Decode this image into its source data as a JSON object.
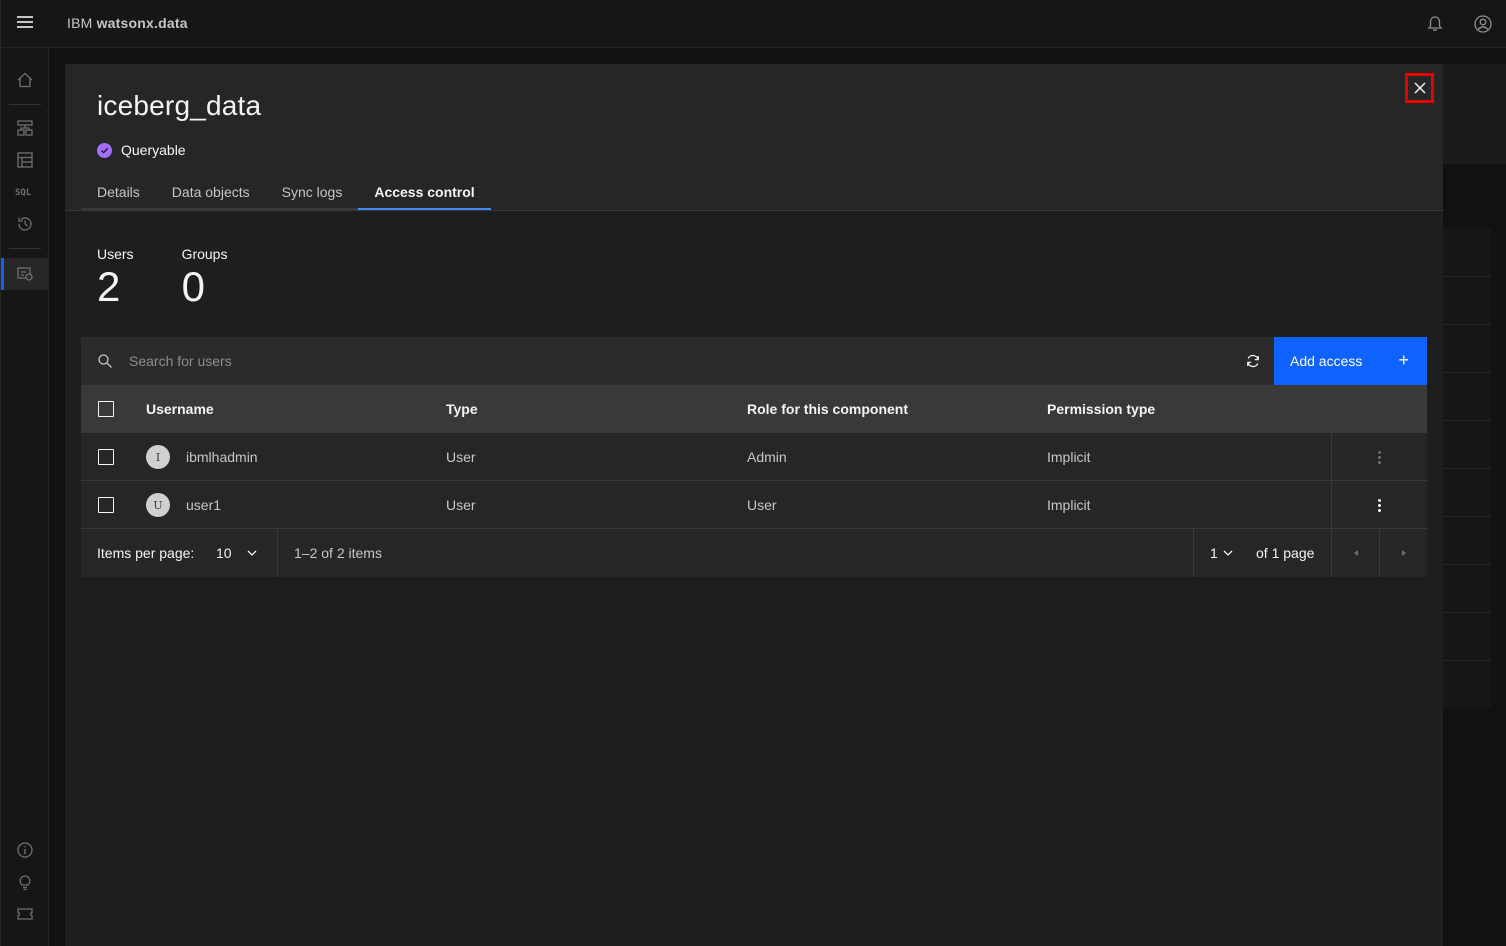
{
  "app": {
    "brand_prefix": "IBM",
    "brand_name": "watsonx.data"
  },
  "modal": {
    "title": "iceberg_data",
    "status": "Queryable",
    "tabs": [
      {
        "label": "Details"
      },
      {
        "label": "Data objects"
      },
      {
        "label": "Sync logs"
      },
      {
        "label": "Access control",
        "active": true
      }
    ],
    "stats": {
      "users_label": "Users",
      "users_value": "2",
      "groups_label": "Groups",
      "groups_value": "0"
    },
    "search": {
      "placeholder": "Search for users"
    },
    "add_button_label": "Add access",
    "table": {
      "headers": [
        "Username",
        "Type",
        "Role for this component",
        "Permission type"
      ],
      "rows": [
        {
          "initial": "I",
          "username": "ibmlhadmin",
          "type": "User",
          "role": "Admin",
          "permission": "Implicit"
        },
        {
          "initial": "U",
          "username": "user1",
          "type": "User",
          "role": "User",
          "permission": "Implicit"
        }
      ]
    },
    "pagination": {
      "items_per_page_label": "Items per page:",
      "items_per_page_value": "10",
      "range_text": "1–2 of 2 items",
      "page_value": "1",
      "page_of_text": "of 1 page"
    }
  },
  "colors": {
    "accent": "#0f62fe",
    "status": "#a56eff",
    "highlight": "#e60000"
  }
}
